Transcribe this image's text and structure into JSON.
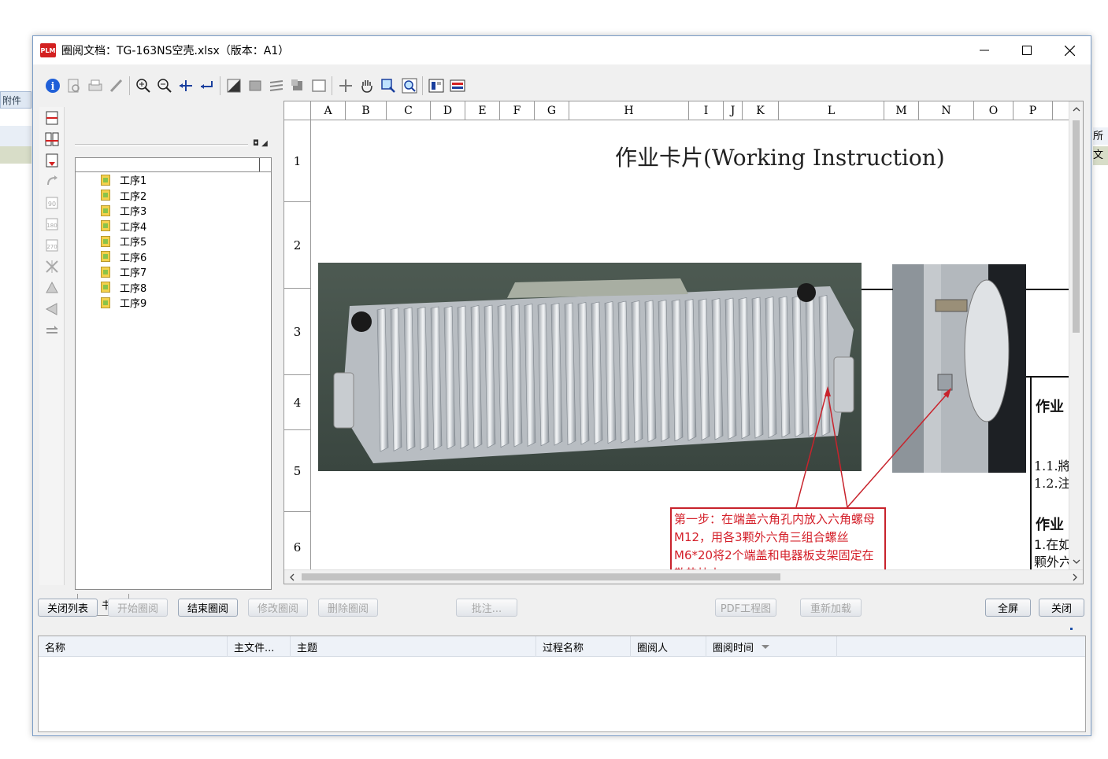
{
  "background": {
    "left_tab": "附件",
    "right_a": "所",
    "right_b": "文"
  },
  "window": {
    "title": "圈阅文档：TG-163NS空壳.xlsx（版本：A1）",
    "logo": "PLM",
    "controls": [
      "minimize-icon",
      "maximize-icon",
      "close-icon"
    ]
  },
  "toolbar": {
    "icons": [
      "info-icon",
      "print-preview-icon",
      "print-icon",
      "pen-icon",
      "zoom-in-icon",
      "zoom-out-icon",
      "fit-width-icon",
      "fit-height-icon",
      "shape-icon",
      "fill-icon",
      "lines-icon",
      "stamp-icon",
      "frame-icon",
      "move-icon",
      "hand-icon",
      "magnifier-icon",
      "zoom-area-icon",
      "layout-icon",
      "ruler-icon"
    ]
  },
  "vstrip": {
    "icons": [
      "cut-page-icon",
      "split-page-icon",
      "merge-page-icon",
      "rotate-icon",
      "rotate-90-icon",
      "rotate-180-icon",
      "rotate-270-icon",
      "mirror-icon",
      "flip-vertical-icon",
      "flip-horizontal-icon",
      "swap-icon"
    ]
  },
  "bookmarks": {
    "items": [
      "工序1",
      "工序2",
      "工序3",
      "工序4",
      "工序5",
      "工序6",
      "工序7",
      "工序8",
      "工序9"
    ],
    "tab_label": "书签"
  },
  "sheet": {
    "columns": [
      "A",
      "B",
      "C",
      "D",
      "E",
      "F",
      "G",
      "H",
      "I",
      "J",
      "K",
      "L",
      "M",
      "N",
      "O",
      "P"
    ],
    "rows": [
      "1",
      "2",
      "3",
      "4",
      "5",
      "6"
    ],
    "title": "作业卡片(Working Instruction)",
    "right_texts": [
      "作业",
      "1.1.將",
      "1.2.注",
      "作业",
      "1.在如",
      "颗外六"
    ],
    "step_note": "第一步：在端盖六角孔内放入六角螺母M12，用各3颗外六角三组合螺丝M6*20将2个端盖和电器板支架固定在散热块上。"
  },
  "buttons": {
    "close_list": "关闭列表",
    "start_review": "开始圈阅",
    "end_review": "结束圈阅",
    "modify_review": "修改圈阅",
    "delete_review": "删除圈阅",
    "annotate": "批注...",
    "pdf_drawing": "PDF工程图",
    "reload": "重新加载",
    "fullscreen": "全屏",
    "close": "关闭"
  },
  "results": {
    "columns": [
      "名称",
      "主文件...",
      "主题",
      "过程名称",
      "圈阅人",
      "圈阅时间"
    ],
    "rows": []
  }
}
